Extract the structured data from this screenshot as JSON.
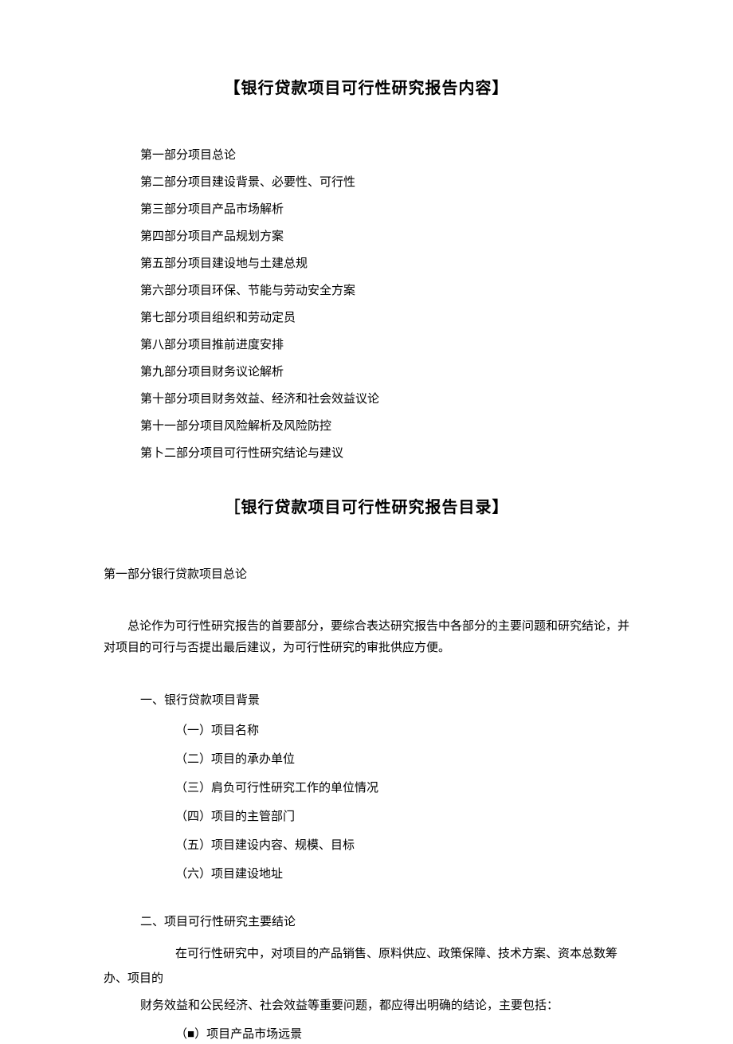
{
  "title1": "【银行贷款项目可行性研究报告内容】",
  "parts": [
    "第一部分项目总论",
    "第二部分项目建设背景、必要性、可行性",
    "第三部分项目产品市场解析",
    "第四部分项目产品规划方案",
    "第五部分项目建设地与土建总规",
    "第六部分项目环保、节能与劳动安全方案",
    "第七部分项目组织和劳动定员",
    "第八部分项目推前进度安排",
    "第九部分项目财务议论解析",
    "第十部分项目财务效益、经济和社会效益议论",
    "第十一部分项目风险解析及风险防控",
    "第卜二部分项目可行性研究结论与建议"
  ],
  "title2": "［银行贷款项目可行性研究报告目录】",
  "section1_head": "第一部分银行贷款项目总论",
  "intro": "总论作为可行性研究报告的首要部分，要综合表达研究报告中各部分的主要问题和研究结论，并对项目的可行与否提出最后建议，为可行性研究的审批供应方便。",
  "sub1_head": "一、银行贷款项目背景",
  "sub1_items": [
    "（一）项目名称",
    "（二）项目的承办单位",
    "（三）肩负可行性研究工作的单位情况",
    "（四）项目的主管部门",
    "（五）项目建设内容、规模、目标",
    "（六）项目建设地址"
  ],
  "sub2_head": "二、项目可行性研究主要结论",
  "sub2_line1": "在可行性研究中，对项目的产品销售、原料供应、政策保障、技术方案、资本总数筹",
  "sub2_line2": "办、项目的",
  "sub2_line3": "财务效益和公民经济、社会效益等重要问题，都应得出明确的结论，主要包括：",
  "sub2_item1a": "（",
  "sub2_item1b": "■",
  "sub2_item1c": "）项目产品市场远景"
}
